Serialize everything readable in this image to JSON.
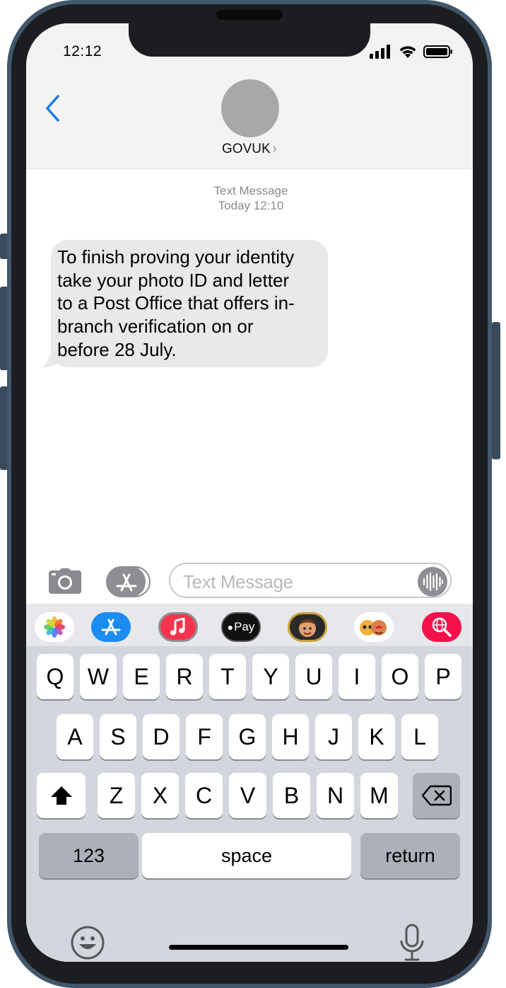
{
  "status_bar": {
    "time": "12:12",
    "signal_icon": "cellular-signal-icon",
    "wifi_icon": "wifi-icon",
    "battery_icon": "battery-icon"
  },
  "header": {
    "back_icon": "chevron-left-icon",
    "contact_name": "GOVUK",
    "contact_chevron": "›",
    "avatar_icon": "avatar-placeholder"
  },
  "conversation": {
    "label": "Text Message",
    "timestamp": "Today 12:10",
    "messages": [
      {
        "lines": [
          "To finish proving your identity",
          "take your photo ID and letter",
          "to a Post Office that offers in-",
          "branch verification on or",
          "before 28 July."
        ]
      }
    ]
  },
  "compose": {
    "placeholder": "Text Message",
    "camera_icon": "camera-icon",
    "apps_icon": "app-store-icon",
    "audio_icon": "audio-waveform-icon"
  },
  "app_drawer": [
    {
      "name": "photos-app-icon",
      "color": "#ffffff"
    },
    {
      "name": "app-store-app-icon",
      "color": "#1a8cf3"
    },
    {
      "name": "music-app-icon",
      "color": "#f5354e"
    },
    {
      "name": "apple-pay-app-icon",
      "color": "#111111",
      "label": "Pay"
    },
    {
      "name": "memoji-app-icon",
      "color": "#2a2a2a"
    },
    {
      "name": "memoji-stickers-app-icon",
      "color": "#ffffff"
    },
    {
      "name": "web-search-app-icon",
      "color": "#f5124a"
    }
  ],
  "keyboard": {
    "row1": [
      "Q",
      "W",
      "E",
      "R",
      "T",
      "Y",
      "U",
      "I",
      "O",
      "P"
    ],
    "row2": [
      "A",
      "S",
      "D",
      "F",
      "G",
      "H",
      "J",
      "K",
      "L"
    ],
    "row3": [
      "Z",
      "X",
      "C",
      "V",
      "B",
      "N",
      "M"
    ],
    "shift_icon": "shift-arrow-icon",
    "delete_icon": "backspace-icon",
    "numbers_label": "123",
    "space_label": "space",
    "return_label": "return",
    "emoji_icon": "emoji-icon",
    "dictation_icon": "microphone-icon"
  },
  "colors": {
    "accent": "#1a7cf0",
    "bubble": "#e9e9eb",
    "keyboard_bg": "#d3d6dd",
    "phone_body": "#1c1d20"
  }
}
